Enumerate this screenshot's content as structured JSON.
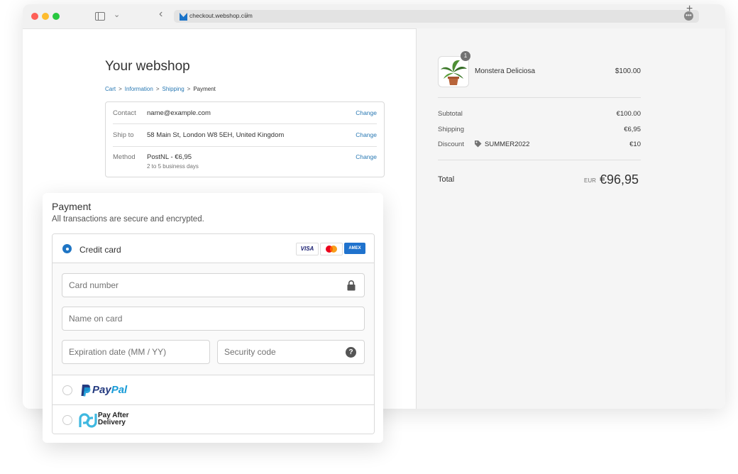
{
  "browser": {
    "url": "checkout.webshop.com"
  },
  "shop": {
    "title": "Your webshop",
    "breadcrumb": [
      "Cart",
      "Information",
      "Shipping",
      "Payment"
    ]
  },
  "review": {
    "contact_label": "Contact",
    "contact_value": "name@example.com",
    "ship_label": "Ship to",
    "ship_value": "58 Main St, London W8 5EH, United Kingdom",
    "method_label": "Method",
    "method_value": "PostNL - €6,95",
    "method_sub": "2 to 5 business days",
    "change_label": "Change"
  },
  "payment": {
    "title": "Payment",
    "subtitle": "All transactions are secure and encrypted.",
    "credit_card_label": "Credit card",
    "card_brands": [
      "VISA",
      "Mastercard",
      "AMEX"
    ],
    "card_number_placeholder": "Card number",
    "name_placeholder": "Name on card",
    "expiry_placeholder": "Expiration date (MM / YY)",
    "security_placeholder": "Security code",
    "paypal_label_1": "Pay",
    "paypal_label_2": "Pal",
    "pad_label_1": "Pay After",
    "pad_label_2": "Delivery"
  },
  "summary": {
    "product_name": "Monstera Deliciosa",
    "product_qty": "1",
    "product_price": "$100.00",
    "subtotal_label": "Subtotal",
    "subtotal_value": "€100.00",
    "shipping_label": "Shipping",
    "shipping_value": "€6,95",
    "discount_label": "Discount",
    "discount_code": "SUMMER2022",
    "discount_value": "€10",
    "total_label": "Total",
    "total_currency": "EUR",
    "total_value": "€96,95"
  },
  "colors": {
    "link": "#2878b3",
    "accent": "#1f75c4",
    "paypal_dark": "#253b80",
    "paypal_light": "#179bd7"
  }
}
